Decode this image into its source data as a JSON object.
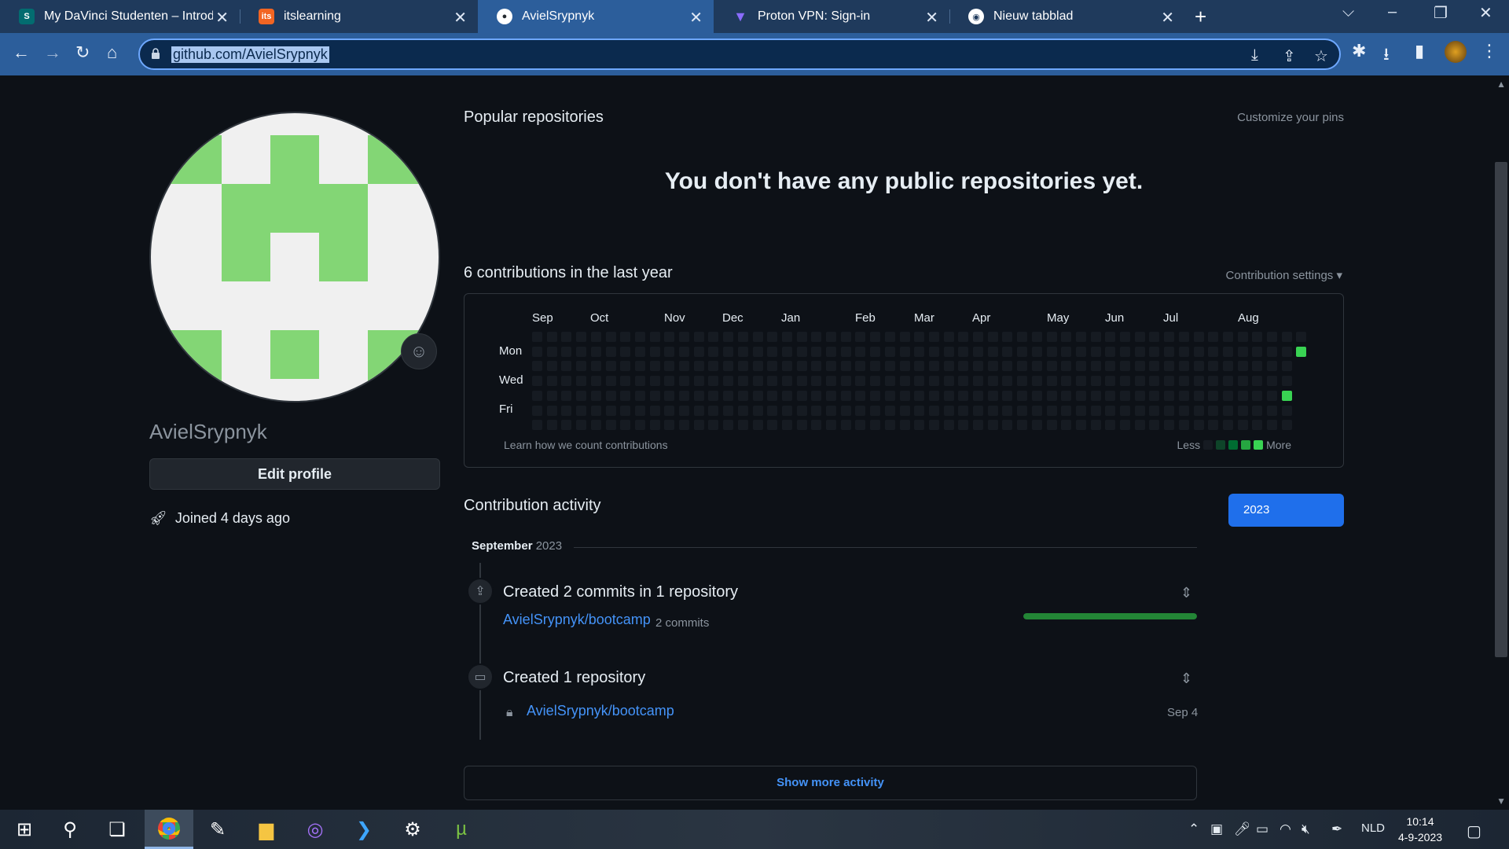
{
  "browser": {
    "tabs": [
      {
        "label": "My DaVinci Studenten – Introduc",
        "icon": "sharepoint-icon",
        "active": false
      },
      {
        "label": "itslearning",
        "icon": "itslearning-icon",
        "active": false
      },
      {
        "label": "AvielSrypnyk",
        "icon": "github-icon",
        "active": true
      },
      {
        "label": "Proton VPN: Sign-in",
        "icon": "protonvpn-icon",
        "active": false
      },
      {
        "label": "Nieuw tabblad",
        "icon": "chrome-icon",
        "active": false
      }
    ],
    "url": "github.com/AvielSrypnyk"
  },
  "profile": {
    "username": "AvielSrypnyk",
    "edit_label": "Edit profile",
    "joined": "Joined 4 days ago"
  },
  "popular": {
    "title": "Popular repositories",
    "customize": "Customize your pins",
    "empty": "You don't have any public repositories yet."
  },
  "contributions": {
    "title": "6 contributions in the last year",
    "settings": "Contribution settings ▾",
    "months": [
      "Sep",
      "Oct",
      "Nov",
      "Dec",
      "Jan",
      "Feb",
      "Mar",
      "Apr",
      "May",
      "Jun",
      "Jul",
      "Aug"
    ],
    "days": [
      "Mon",
      "Wed",
      "Fri"
    ],
    "learn": "Learn how we count contributions",
    "less": "Less",
    "more": "More",
    "active_cells": [
      {
        "week": 52,
        "day": 1
      },
      {
        "week": 51,
        "day": 4
      }
    ]
  },
  "activity": {
    "title": "Contribution activity",
    "year": "2023",
    "month": "September",
    "month_year": "2023",
    "items": [
      {
        "title": "Created 2 commits in 1 repository",
        "repo": "AvielSrypnyk/bootcamp",
        "meta": "2 commits",
        "progress": 1.0
      },
      {
        "title": "Created 1 repository",
        "repo": "AvielSrypnyk/bootcamp",
        "date": "Sep 4"
      }
    ],
    "show_more": "Show more activity"
  },
  "taskbar": {
    "lang": "NLD",
    "time": "10:14",
    "date": "4-9-2023"
  },
  "colors": {
    "accent": "#1f6feb",
    "link": "#4493f8",
    "contrib_green": "#39d353",
    "avatar_green": "#83d675"
  }
}
